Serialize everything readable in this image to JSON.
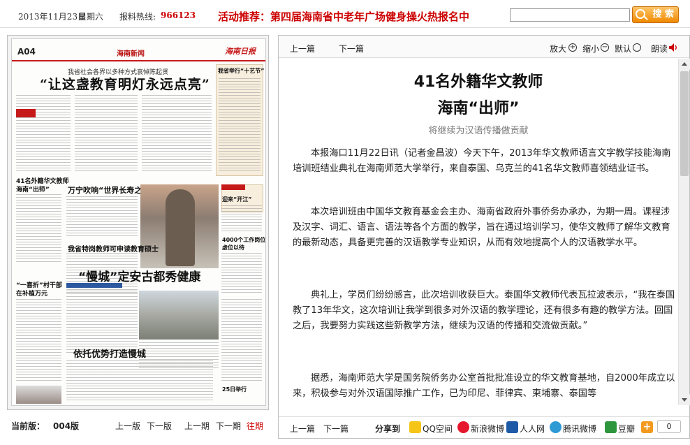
{
  "topbar": {
    "date": "2013年11月23日",
    "weekday": "星期六",
    "hotline_label": "报料热线:",
    "hotline": "966123",
    "promo": "活动推荐：第四届海南省中老年广场健身操火热报名中",
    "search_placeholder": "",
    "search_button": "搜 索"
  },
  "newspaper": {
    "page_no": "A04",
    "section": "海南新闻",
    "logo": "海南日报",
    "kicker": "我省社会各界以多种方式哀悼陈起贤",
    "lead_headline": "“让这盏教育明灯永远点亮”",
    "headlines": {
      "h1": "41名外籍华文教师",
      "h1b": "海南“出师”",
      "h2": "万宁吹响“世界长寿之乡”",
      "h3": "我省特岗教师可申读教育硕士",
      "h4": "“一喜折”村干部",
      "h4b": "在补植万元",
      "h5": "“慢城”定安古都秀健康",
      "h6": "依托优势打造慢城",
      "h7": "4000个工作岗位",
      "h7b": "虚位以待",
      "h8": "25日举行",
      "h9": "迎来“开江”",
      "h10": "我省举行“十艺节”"
    }
  },
  "left_footer": {
    "current_label": "当前版：",
    "current_page": "004版",
    "prev_page": "上一版",
    "next_page": "下一版",
    "prev_issue": "上一期",
    "next_issue": "下一期",
    "past": "往期"
  },
  "toolbar": {
    "prev_article": "上一篇",
    "next_article": "下一篇",
    "zoom_in": "放大",
    "zoom_out": "缩小",
    "default": "默认",
    "read_aloud": "朗读"
  },
  "article": {
    "title_line1": "41名外籍华文教师",
    "title_line2": "海南“出师”",
    "subtitle": "将继续为汉语传播做贡献",
    "paragraphs": [
      "本报海口11月22日讯（记者金昌波）今天下午，2013年华文教师语言文字教学技能海南培训班结业典礼在海南师范大学举行，来自泰国、乌克兰的41名华文教师喜领结业证书。",
      "本次培训班由中国华文教育基金会主办、海南省政府外事侨务办承办，为期一周。课程涉及汉字、词汇、语言、语法等各个方面的教学，旨在通过培训学习，使华文教师了解华文教育的最新动态，具备更完善的汉语教学专业知识，从而有效地提高个人的汉语教学水平。",
      "典礼上，学员们纷纷感言，此次培训收获巨大。泰国华文教师代表瓦拉波表示，“我在泰国教了13年华文，这次培训让我学到很多对外汉语的教学理论，还有很多有趣的教学方法。回国之后，我要努力实践这些新教学方法，继续为汉语的传播和交流做贡献。”",
      "据悉，海南师范大学是国务院侨务办公室首批批准设立的华文教育基地，自2000年成立以来，积极参与对外汉语国际推广工作，已为印尼、菲律宾、柬埔寨、泰国等"
    ]
  },
  "footer": {
    "prev_article": "上一篇",
    "next_article": "下一篇",
    "share_label": "分享到",
    "share_targets": [
      "QQ空间",
      "新浪微博",
      "人人网",
      "腾讯微博",
      "豆瓣"
    ],
    "share_count": "0"
  },
  "colors": {
    "accent_red": "#cc0000",
    "search_orange": "#f08a00"
  }
}
